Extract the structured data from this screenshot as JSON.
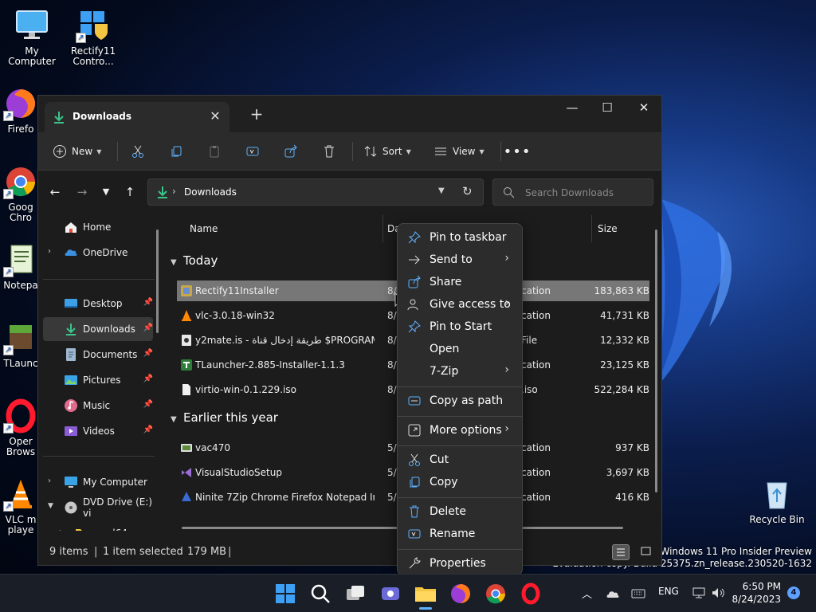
{
  "desktop": {
    "icons": [
      {
        "label": "My Computer"
      },
      {
        "label": "Rectify11 Contro..."
      },
      {
        "label": "Firefo"
      },
      {
        "label": "Goog Chro"
      },
      {
        "label": "Notepa"
      },
      {
        "label": "TLaunc"
      },
      {
        "label": "Oper Brows"
      },
      {
        "label": "VLC m playe"
      },
      {
        "label": "Recycle Bin"
      }
    ],
    "watermark_line1": "Windows 11 Pro Insider Preview",
    "watermark_line2": "Evaluation copy. Build 25375.zn_release.230520-1632"
  },
  "window": {
    "tab_title": "Downloads",
    "toolbar": {
      "new_label": "New",
      "sort_label": "Sort",
      "view_label": "View"
    },
    "address": {
      "path": "Downloads",
      "search_placeholder": "Search Downloads"
    },
    "nav": {
      "home": "Home",
      "onedrive": "OneDrive",
      "desktop": "Desktop",
      "downloads": "Downloads",
      "documents": "Documents",
      "pictures": "Pictures",
      "music": "Music",
      "videos": "Videos",
      "my_computer": "My Computer",
      "dvd": "DVD Drive (E:) vi",
      "amd64": "amd64"
    },
    "columns": {
      "name": "Name",
      "date": "Da",
      "size": "Size"
    },
    "groups": {
      "today": "Today",
      "earlier": "Earlier this year"
    },
    "files_today": [
      {
        "name": "Rectify11Installer",
        "date": "8/",
        "type": "cation",
        "size": "183,863 KB"
      },
      {
        "name": "vlc-3.0.18-win32",
        "date": "8/",
        "type": "cation",
        "size": "41,731 KB"
      },
      {
        "name": "y2mate.is - طريقة إدخال قناة $PROGRAM...",
        "date": "8/",
        "type": "File",
        "size": "12,332 KB"
      },
      {
        "name": "TLauncher-2.885-Installer-1.1.3",
        "date": "8/",
        "type": "cation",
        "size": "23,125 KB"
      },
      {
        "name": "virtio-win-0.1.229.iso",
        "date": "8/",
        "type": ".iso",
        "size": "522,284 KB"
      }
    ],
    "files_earlier": [
      {
        "name": "vac470",
        "date": "5/",
        "type": "cation",
        "size": "937 KB"
      },
      {
        "name": "VisualStudioSetup",
        "date": "5/",
        "type": "cation",
        "size": "3,697 KB"
      },
      {
        "name": "Ninite 7Zip Chrome Firefox Notepad Inst...",
        "date": "5/",
        "type": "cation",
        "size": "416 KB"
      }
    ],
    "status": {
      "items": "9 items",
      "selected": "1 item selected",
      "size": "179 MB",
      "sep": "|"
    }
  },
  "context_menu": {
    "pin_taskbar": "Pin to taskbar",
    "send_to": "Send to",
    "share": "Share",
    "give_access": "Give access to",
    "pin_start": "Pin to Start",
    "open": "Open",
    "sevenzip": "7-Zip",
    "copy_path": "Copy as path",
    "more_options": "More options",
    "cut": "Cut",
    "copy": "Copy",
    "delete": "Delete",
    "rename": "Rename",
    "properties": "Properties"
  },
  "taskbar": {
    "language": "ENG",
    "time": "6:50 PM",
    "date": "8/24/2023",
    "notifications": "4"
  },
  "colors": {
    "accent": "#5fb2ff",
    "window_bg": "#1c1c1c",
    "selection": "#777777",
    "folder": "#f4c542",
    "download_green": "#3cc48a"
  }
}
